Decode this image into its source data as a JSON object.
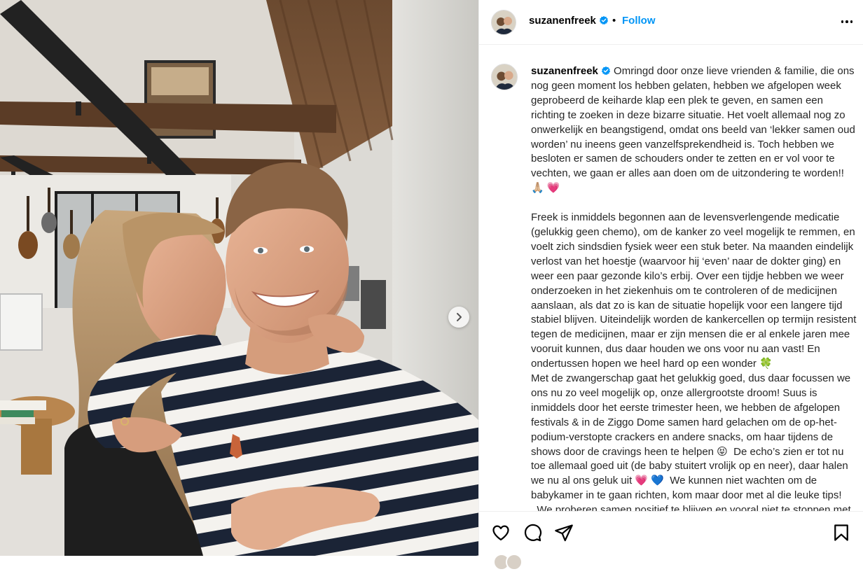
{
  "post": {
    "username": "suzanenfreek",
    "follow_label": "Follow",
    "separator": "•",
    "caption_paragraphs": [
      "Omringd door onze lieve vrienden & familie, die ons nog geen moment los hebben gelaten, hebben we afgelopen week geprobeerd de keiharde klap een plek te geven, en samen een richting te zoeken in deze bizarre situatie. Het voelt allemaal nog zo onwerkelijk en beangstigend, omdat ons beeld van ‘lekker samen oud worden’ nu ineens geen vanzelfsprekendheid is. Toch hebben we besloten er samen de schouders onder te zetten en er vol voor te vechten, we gaan er alles aan doen om de uitzondering te worden!! 🙏🏼 💗",
      "Freek is inmiddels begonnen aan de levensverlengende medicatie (gelukkig geen chemo), om de kanker zo veel mogelijk te remmen, en voelt zich sindsdien fysiek weer een stuk beter. Na maanden eindelijk verlost van het hoestje (waarvoor hij ‘even’ naar de dokter ging) en weer een paar gezonde kilo’s erbij. Over een tijdje hebben we weer onderzoeken in het ziekenhuis om te controleren of de medicijnen aanslaan, als dat zo is kan de situatie hopelijk voor een langere tijd stabiel blijven. Uiteindelijk worden de kankercellen op termijn resistent tegen de medicijnen, maar er zijn mensen die er al enkele jaren mee vooruit kunnen, dus daar houden we ons voor nu aan vast! En ondertussen hopen we heel hard op een wonder 🍀\nMet de zwangerschap gaat het gelukkig goed, dus daar focussen we ons nu zo veel mogelijk op, onze allergrootste droom! Suus is inmiddels door het eerste trimester heen, we hebben de afgelopen festivals & in de Ziggo Dome samen hard gelachen om de op-het-podium-verstopte crackers en andere snacks, om haar tijdens de shows door de cravings heen te helpen 😝  De echo’s zien er tot nu toe allemaal goed uit (de baby stuitert vrolijk op en neer), daar halen we nu al ons geluk uit 💗 💙  We kunnen niet wachten om de babykamer in te gaan richten, kom maar door met al die leuke tips!\n  We proberen samen positief te blijven en vooral niet te stoppen met leven. We hebben tot nu toe nog elke dag samen muziek"
    ]
  },
  "icons": {
    "header_avatar": "profile-avatar-icon",
    "verified": "verified-badge-icon",
    "more": "more-options-icon",
    "next": "chevron-right-icon",
    "like": "heart-icon",
    "comment": "comment-icon",
    "share": "share-icon",
    "save": "bookmark-icon"
  },
  "colors": {
    "follow": "#0095f6",
    "verified": "#0095f6",
    "text": "#262626",
    "divider": "#efefef"
  }
}
